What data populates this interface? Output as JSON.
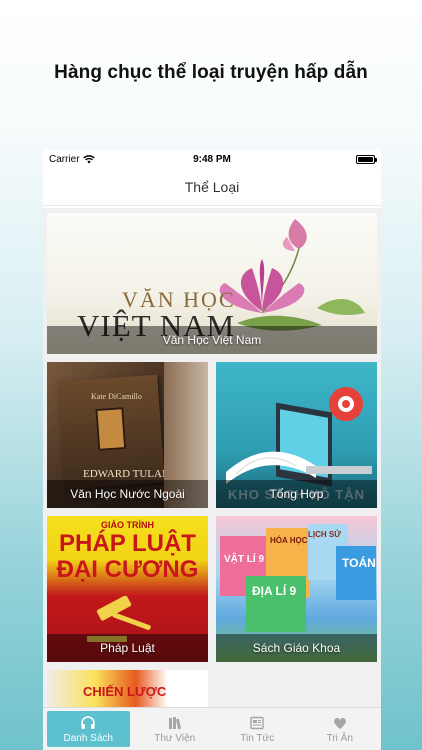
{
  "headline": "Hàng chục thể loại truyện hấp dẫn",
  "status": {
    "carrier": "Carrier",
    "time": "9:48 PM"
  },
  "nav": {
    "title": "Thể Loại"
  },
  "categories": [
    {
      "label": "Văn Học Việt Nam",
      "cover_text": [
        "VĂN HỌC",
        "VIỆT NAM"
      ]
    },
    {
      "label": "Văn Học Nước Ngoài",
      "cover_text": [
        "Kate DiCamillo",
        "EDWARD TULANE"
      ]
    },
    {
      "label": "Tổng Hợp",
      "cover_text": [
        "KHO SÁCH VÔ TẬN"
      ]
    },
    {
      "label": "Pháp Luật",
      "cover_text": [
        "GIÁO TRÌNH",
        "PHÁP LUẬT",
        "ĐẠI CƯƠNG"
      ]
    },
    {
      "label": "Sách Giáo Khoa",
      "cover_text": [
        "LỊCH SỬ",
        "HÓA HỌC",
        "TOÁN",
        "VẬT LÍ 9",
        "ĐỊA LÍ 9"
      ]
    },
    {
      "label": "",
      "cover_text": [
        "CHIẾN LƯỢC"
      ]
    }
  ],
  "tabs": [
    {
      "label": "Danh Sách",
      "icon": "headphones-icon",
      "active": true
    },
    {
      "label": "Thư Viện",
      "icon": "books-icon",
      "active": false
    },
    {
      "label": "Tin Tức",
      "icon": "newspaper-icon",
      "active": false
    },
    {
      "label": "Tri Ân",
      "icon": "heart-icon",
      "active": false
    }
  ],
  "colors": {
    "accent": "#5dc0cf"
  }
}
